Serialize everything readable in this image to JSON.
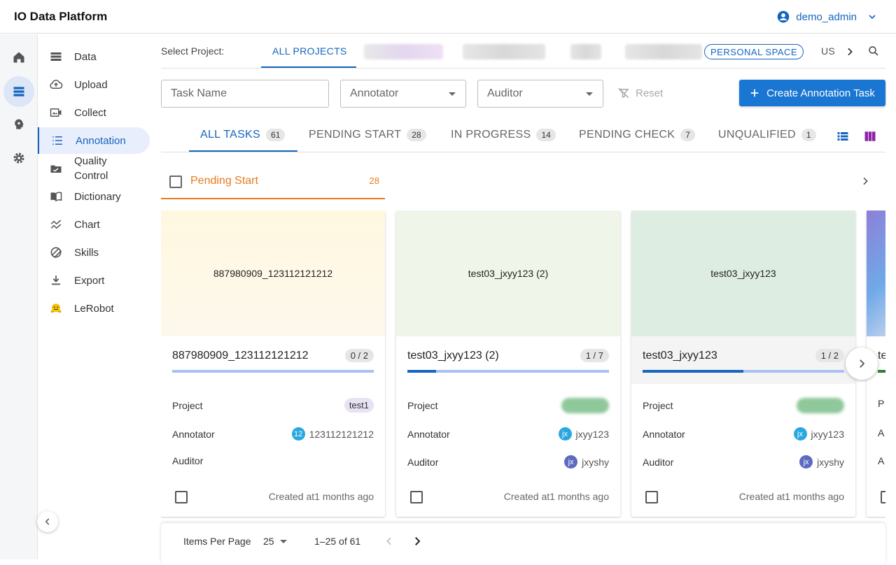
{
  "app": {
    "title": "IO Data Platform",
    "user": "demo_admin"
  },
  "sidebar": {
    "items": [
      {
        "label": "Data",
        "icon": "storage-icon"
      },
      {
        "label": "Upload",
        "icon": "cloud-upload-icon"
      },
      {
        "label": "Collect",
        "icon": "video-collect-icon"
      },
      {
        "label": "Annotation",
        "icon": "list-numbered-icon",
        "active": true
      },
      {
        "label": "Quality Control",
        "icon": "image-check-icon"
      },
      {
        "label": "Dictionary",
        "icon": "book-icon"
      },
      {
        "label": "Chart",
        "icon": "chart-line-icon"
      },
      {
        "label": "Skills",
        "icon": "skills-icon"
      },
      {
        "label": "Export",
        "icon": "download-icon"
      },
      {
        "label": "LeRobot",
        "icon": "hugging-face-icon"
      }
    ]
  },
  "projects": {
    "label": "Select Project:",
    "tabs": [
      "ALL PROJECTS",
      "PERSONAL SPACE",
      "US"
    ]
  },
  "filters": {
    "task_name_placeholder": "Task Name",
    "annotator_placeholder": "Annotator",
    "auditor_placeholder": "Auditor",
    "reset_label": "Reset",
    "create_label": "Create Annotation Task"
  },
  "tabs": [
    {
      "label": "ALL TASKS",
      "count": "61"
    },
    {
      "label": "PENDING START",
      "count": "28"
    },
    {
      "label": "IN PROGRESS",
      "count": "14"
    },
    {
      "label": "PENDING CHECK",
      "count": "7"
    },
    {
      "label": "UNQUALIFIED",
      "count": "1"
    }
  ],
  "group": {
    "title": "Pending Start",
    "count": "28"
  },
  "cards": [
    {
      "thumb": "887980909_123112121212",
      "title": "887980909_123112121212",
      "progress": "0 / 2",
      "progress_fraction": 0,
      "project_label": "Project",
      "project": "test1",
      "annotator_label": "Annotator",
      "annotator_avatar": "12",
      "annotator": "123112121212",
      "auditor_label": "Auditor",
      "auditor_avatar": "",
      "auditor": "",
      "created": "Created at1 months ago"
    },
    {
      "thumb": "test03_jxyy123 (2)",
      "title": "test03_jxyy123 (2)",
      "progress": "1 / 7",
      "progress_fraction": 0.143,
      "project_label": "Project",
      "project": "",
      "annotator_label": "Annotator",
      "annotator_avatar": "jx",
      "annotator": "jxyy123",
      "auditor_label": "Auditor",
      "auditor_avatar": "jx",
      "auditor": "jxyshy",
      "created": "Created at1 months ago"
    },
    {
      "thumb": "test03_jxyy123",
      "title": "test03_jxyy123",
      "progress": "1 / 2",
      "progress_fraction": 0.5,
      "project_label": "Project",
      "project": "",
      "annotator_label": "Annotator",
      "annotator_avatar": "jx",
      "annotator": "jxyy123",
      "auditor_label": "Auditor",
      "auditor_avatar": "jx",
      "auditor": "jxyshy",
      "created": "Created at1 months ago"
    }
  ],
  "card4": {
    "title": "te",
    "p": "P",
    "a": "A",
    "a2": "A"
  },
  "pager": {
    "items_per_page_label": "Items Per Page",
    "items_per_page": "25",
    "range": "1–25 of 61"
  },
  "colors": {
    "accent": "#1565c0",
    "group": "#e87b1d",
    "card1": "#fdf6e0",
    "card2": "#edf4e6",
    "card3": "#deede2"
  }
}
